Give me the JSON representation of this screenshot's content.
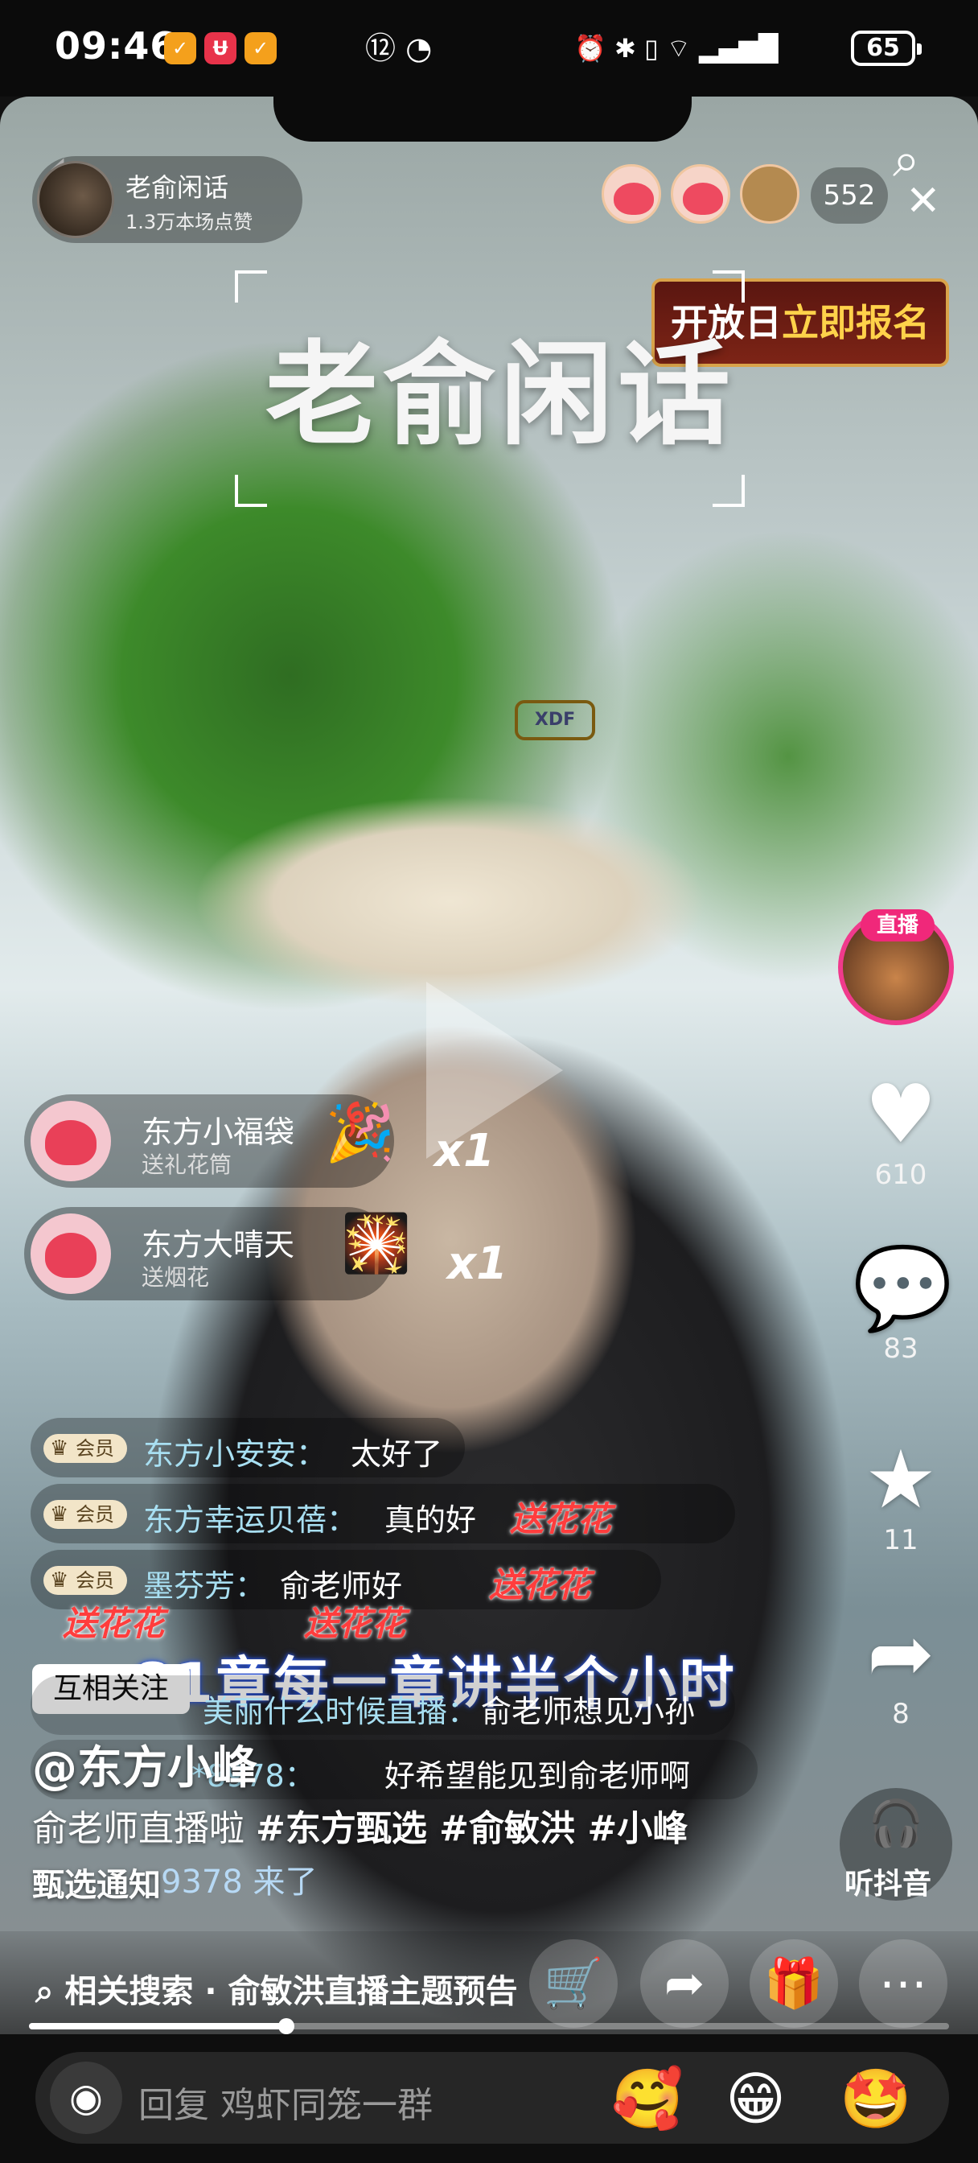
{
  "status_bar": {
    "time": "09:46",
    "badge_1": "✓",
    "badge_2": "Ʉ",
    "badge_3": "✓",
    "sb_icons_left": "⑫ ◔",
    "sb_icons_right": "⏰ ✱ ▯ ⌔ ▂▄▆█",
    "battery": "65"
  },
  "header": {
    "host_name": "老俞闲话",
    "host_likes": "1.3万本场点赞",
    "viewer_count": "552",
    "back_glyph": "‹",
    "search_glyph": "⌕",
    "close_glyph": "✕"
  },
  "banner": {
    "part1": "开放日",
    "part2": "立即报名"
  },
  "show_title": "老俞闲话",
  "cap_logo_text": "XDF",
  "live_preview": {
    "tag": "直播"
  },
  "side_actions": {
    "like_count": "610",
    "comment_count": "83",
    "star_count": "11",
    "share_count": "8"
  },
  "gifts": [
    {
      "name": "东方小福袋",
      "sub": "送礼花筒",
      "icon": "🎉",
      "mult": "x1"
    },
    {
      "name": "东方大晴天",
      "sub": "送烟花",
      "icon": "🎇",
      "mult": "x1"
    }
  ],
  "chat": {
    "vip_label": "会员",
    "flower": "送花花",
    "rows": [
      {
        "user": "东方小安安：",
        "text": "太好了"
      },
      {
        "user": "东方幸运贝蓓：",
        "text": "真的好"
      },
      {
        "user": "墨芬芳：",
        "text": "俞老师好"
      },
      {
        "user": "美丽什么时候直播：",
        "text": "俞老师想见小孙"
      },
      {
        "user": "*8978：",
        "text": "好希望能见到俞老师啊"
      }
    ]
  },
  "caption_overlay": "81章每一章讲半个小时",
  "mutual_follow": "互相关注",
  "author": "@东方小峰",
  "description": {
    "prefix": "俞老师直播啦",
    "tags": "#东方甄选 #俞敏洪 #小峰",
    "line2": "甄选通知",
    "join": "9378 来了"
  },
  "listen": {
    "label": "听抖音",
    "icon": "🎧"
  },
  "bottom": {
    "related": "相关搜索 · 俞敏洪直播主题预告",
    "search_icon": "⌕",
    "cart_icon": "🛒",
    "share_icon": "➦",
    "gift_icon": "🎁",
    "more_icon": "⋯"
  },
  "progress": {
    "fraction": 0.28
  },
  "comment_bar": {
    "placeholder": "回复 鸡虾同笼一群",
    "camera_icon": "◉",
    "emojis": [
      "🥰",
      "😁",
      "🤩"
    ]
  }
}
